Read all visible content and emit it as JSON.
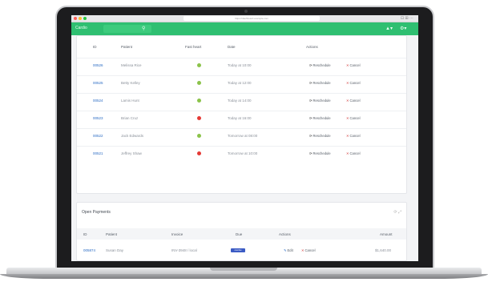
{
  "browser": {
    "url": "https://dashboard.example.com",
    "tools": "⊡ ⊞ ⋯"
  },
  "header": {
    "brand": "Cardio",
    "search_icon": "search-icon",
    "alerts_label": "▲▾",
    "settings_label": "⚙▾"
  },
  "appointments": {
    "columns": [
      "ID",
      "Patient",
      "Fast heart",
      "Date",
      "Actions"
    ],
    "reschedule_label": "Reschedule",
    "cancel_label": "Cancel",
    "rows": [
      {
        "id": "00526",
        "patient": "Melissa Rice",
        "status": "ok",
        "date": "Today at 10:00"
      },
      {
        "id": "00525",
        "patient": "Betty Kelley",
        "status": "ok",
        "date": "Today at 12:00"
      },
      {
        "id": "00524",
        "patient": "Lamis Hunt",
        "status": "ok",
        "date": "Today at 14:00"
      },
      {
        "id": "00523",
        "patient": "Brian Cruz",
        "status": "alert",
        "date": "Today at 16:00"
      },
      {
        "id": "00522",
        "patient": "Jack Edwards",
        "status": "ok",
        "date": "Tomorrow at 08:00"
      },
      {
        "id": "00521",
        "patient": "Jeffrey Shaw",
        "status": "alert",
        "date": "Tomorrow at 10:00"
      }
    ]
  },
  "payments": {
    "title": "Open Payments",
    "columns": [
      "ID",
      "Patient",
      "Invoice",
      "Due",
      "Actions",
      "Amount"
    ],
    "edit_label": "Edit",
    "cancel_label": "Cancel",
    "rows": [
      {
        "id": "005874",
        "patient": "Susan Day",
        "invoice": "INV-3948 / local",
        "due": "overdue",
        "amount": "$1,640.00"
      }
    ]
  },
  "colors": {
    "brand": "#2fbf71",
    "link": "#2b6cc4",
    "ok": "#8bc34a",
    "alert": "#e53935",
    "badge": "#3b5bc4"
  }
}
